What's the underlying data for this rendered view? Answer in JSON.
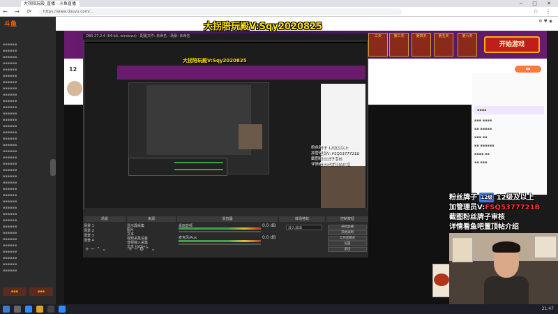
{
  "browser": {
    "tab_title": "大拐陪玩殿_直播 - 斗鱼直播",
    "url": "https://www.douyu.com/..."
  },
  "site": {
    "logo": "斗鱼"
  },
  "stream": {
    "title_overlay": "大拐陪玩殿V:Sqy2020825",
    "level_number": "12",
    "start_game_button": "开始游戏",
    "banner_items": [
      "三天",
      "第三天",
      "第四天",
      "第五天",
      "第六天"
    ]
  },
  "overlay": {
    "line1_a": "粉丝牌子",
    "line1_badge": "12级",
    "line1_b": "12级及以上",
    "line2_a": "加管理员V:",
    "line2_red": "FSQ5377721B",
    "line3": "截图粉丝牌子审核",
    "line4": "详情看鱼吧置顶帖介绍"
  },
  "nested": {
    "overlay_lines": [
      "粉丝牌子 12级及以上",
      "加管理员V: FSQ5377721B",
      "截图粉丝牌子审核",
      "详情看鱼吧置顶帖介绍"
    ]
  },
  "obs": {
    "title": "OBS 27.2.4 (64-bit, windows) - 配置文件: 未命名 - 场景: 未命名",
    "scenes_title": "场景",
    "sources_title": "来源",
    "mixer_title": "混音器",
    "transitions_title": "转场特效",
    "controls_title": "控制按钮",
    "scenes": [
      "场景 1",
      "场景 2",
      "场景 3",
      "场景 4"
    ],
    "sources": [
      "显示器采集",
      "图片",
      "文本",
      "视频采集设备",
      "音频输入采集",
      "文本 (GDI+)"
    ],
    "mixer": [
      {
        "label": "桌面音频",
        "value": "0.0 dB"
      },
      {
        "label": "麦克风/Aux",
        "value": "0.0 dB"
      }
    ],
    "transition": "淡入淡出",
    "controls": [
      "开始直播",
      "开始录制",
      "工作室模式",
      "设置",
      "退出"
    ]
  },
  "taskbar": {
    "time": "21:47"
  }
}
